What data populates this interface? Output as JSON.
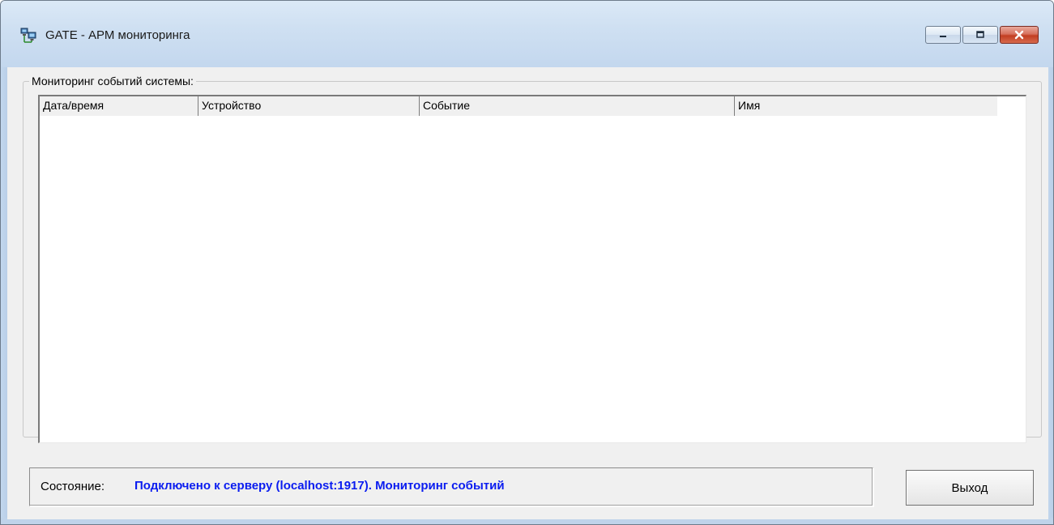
{
  "window": {
    "title": "GATE - АРМ мониторинга",
    "icon": "network-computers-icon",
    "caption_buttons": [
      "minimize",
      "maximize",
      "close"
    ]
  },
  "events_group": {
    "label": "Мониторинг событий системы:",
    "columns": [
      "Дата/время",
      "Устройство",
      "Событие",
      "Имя"
    ],
    "rows": []
  },
  "status": {
    "label": "Состояние:",
    "value": "Подключено к серверу (localhost:1917). Мониторинг событий",
    "value_color": "#0a1cf0"
  },
  "exit_button": {
    "label": "Выход"
  }
}
